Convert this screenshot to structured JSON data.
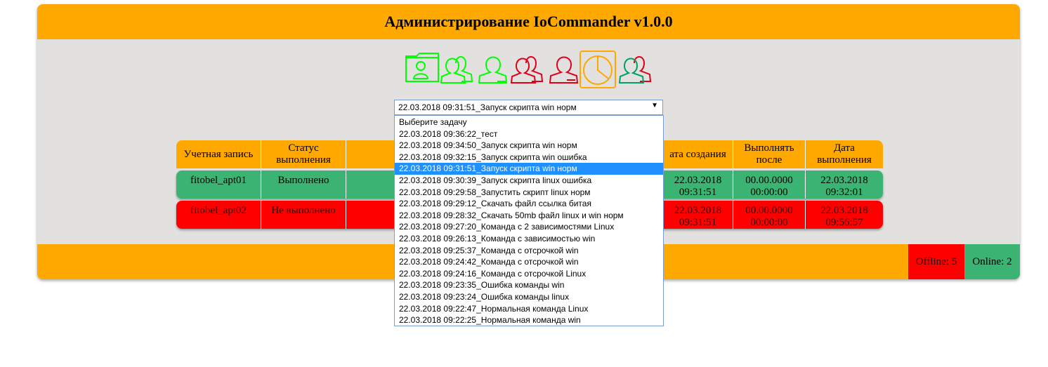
{
  "header": {
    "title": "Администрирование IoCommander v1.0.0"
  },
  "toolbar": {
    "icons": [
      {
        "name": "user-folder-icon",
        "color": "#00ff00"
      },
      {
        "name": "users-group-icon",
        "color": "#00ff00"
      },
      {
        "name": "user-edit-icon",
        "color": "#00ff00"
      },
      {
        "name": "users-group-icon-red",
        "color": "#e0001b"
      },
      {
        "name": "user-remove-icon",
        "color": "#e0001b"
      },
      {
        "name": "pie-chart-icon",
        "color": "#ffa800"
      },
      {
        "name": "users-group-icon-mixed",
        "color": "#00a060"
      }
    ]
  },
  "task_select": {
    "value": "22.03.2018 09:31:51_Запуск скрипта win норм",
    "options": [
      "Выберите задачу",
      "22.03.2018 09:36:22_тест",
      "22.03.2018 09:34:50_Запуск скрипта win норм",
      "22.03.2018 09:32:15_Запуск скрипта win ошибка",
      "22.03.2018 09:31:51_Запуск скрипта win норм",
      "22.03.2018 09:30:39_Запуск скрипта linux ошибка",
      "22.03.2018 09:29:58_Запустить скрипт linux норм",
      "22.03.2018 09:29:12_Скачать файл ссылка битая",
      "22.03.2018 09:28:32_Скачать 50mb файл linux и win норм",
      "22.03.2018 09:27:20_Команда с 2 зависимостями Linux",
      "22.03.2018 09:26:13_Команда с зависимостью win",
      "22.03.2018 09:25:37_Команда с отсрочкой win",
      "22.03.2018 09:24:42_Команда с отсрочкой win",
      "22.03.2018 09:24:16_Команда с отсрочкой Linux",
      "22.03.2018 09:23:35_Ошибка команды win",
      "22.03.2018 09:23:24_Ошибка команды linux",
      "22.03.2018 09:22:47_Нормальная команда Linux",
      "22.03.2018 09:22:25_Нормальная команда win"
    ],
    "selected_index": 4
  },
  "table": {
    "headers": {
      "account": "Учетная запись",
      "status": "Статус выполнения",
      "created": "ата создания",
      "run_after": "Выполнять после",
      "executed": "Дата выполнения"
    },
    "rows": [
      {
        "account": "fitobel_apt01",
        "status": "Выполнено",
        "created": "22.03.2018 09:31:51",
        "run_after": "00.00.0000 00:00:00",
        "executed": "22.03.2018 09:32:01",
        "state": "ok"
      },
      {
        "account": "fitobel_apt02",
        "status": "Не выполнено",
        "created": "22.03.2018 09:31:51",
        "run_after": "00.00.0000 00:00:00",
        "executed": "22.03.2018 09:56:57",
        "state": "fail"
      }
    ]
  },
  "footer": {
    "offline": "Offline: 5",
    "online": "Online: 2"
  },
  "colors": {
    "accent": "#ffa800",
    "ok": "#3bb372",
    "fail": "#ff0000",
    "panel": "#e2e1e0"
  }
}
